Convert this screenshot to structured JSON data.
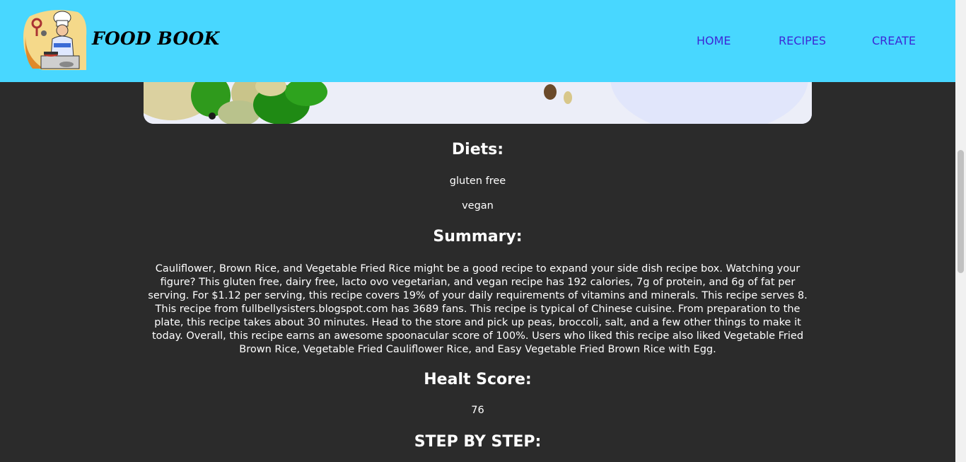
{
  "navbar": {
    "brand": "FOOD BOOK",
    "links": [
      {
        "label": "HOME"
      },
      {
        "label": "RECIPES"
      },
      {
        "label": "CREATE"
      }
    ],
    "background": "#48d7ff",
    "link_color": "#3d29d6"
  },
  "recipe": {
    "diets_heading": "Diets:",
    "diets": [
      "gluten free",
      "vegan"
    ],
    "summary_heading": "Summary:",
    "summary": "Cauliflower, Brown Rice, and Vegetable Fried Rice might be a good recipe to expand your side dish recipe box. Watching your figure? This gluten free, dairy free, lacto ovo vegetarian, and vegan recipe has 192 calories, 7g of protein, and 6g of fat per serving. For $1.12 per serving, this recipe covers 19% of your daily requirements of vitamins and minerals. This recipe serves 8. This recipe from fullbellysisters.blogspot.com has 3689 fans. This recipe is typical of Chinese cuisine. From preparation to the plate, this recipe takes about 30 minutes. Head to the store and pick up peas, broccoli, salt, and a few other things to make it today. Overall, this recipe earns an awesome spoonacular score of 100%. Users who liked this recipe also liked Vegetable Fried Brown Rice, Vegetable Fried Cauliflower Rice, and Easy Vegetable Fried Brown Rice with Egg.",
    "health_heading": "Healt Score:",
    "health_score": "76",
    "steps_heading": "STEP BY STEP:"
  },
  "colors": {
    "page_background": "#2b2b2b",
    "text": "#ffffff"
  },
  "icons": {
    "logo": "chef-cooking-logo"
  }
}
